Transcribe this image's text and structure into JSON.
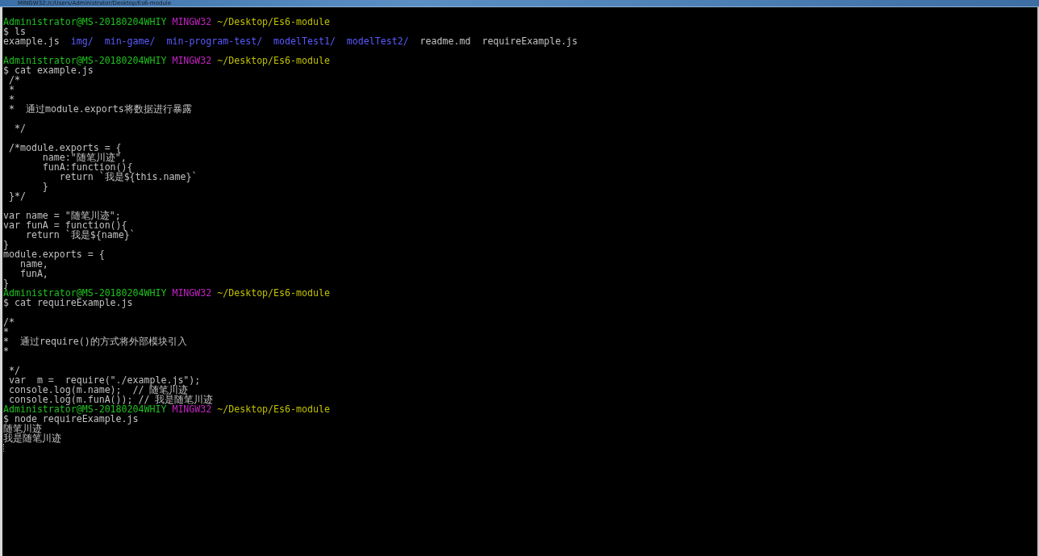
{
  "window": {
    "title": "MINGW32:/c/Users/Administrator/Desktop/Es6-module"
  },
  "terminal": {
    "cursor": true,
    "lines": [
      {
        "kind": "blank"
      },
      {
        "kind": "prompt",
        "segments": [
          {
            "text": "Administrator@MS-20180204WHIY",
            "kind": "user"
          },
          {
            "text": "MINGW32",
            "kind": "system"
          },
          {
            "text": "~/Desktop/Es6-module",
            "kind": "path"
          }
        ]
      },
      {
        "kind": "text",
        "text": "$ ls"
      },
      {
        "kind": "listing",
        "segments": [
          {
            "text": "example.js",
            "kind": "file"
          },
          {
            "text": "img/",
            "kind": "dir"
          },
          {
            "text": "min-game/",
            "kind": "dir"
          },
          {
            "text": "min-program-test/",
            "kind": "dir"
          },
          {
            "text": "modelTest1/",
            "kind": "dir"
          },
          {
            "text": "modelTest2/",
            "kind": "dir"
          },
          {
            "text": "readme.md",
            "kind": "file"
          },
          {
            "text": "requireExample.js",
            "kind": "file"
          }
        ]
      },
      {
        "kind": "blank"
      },
      {
        "kind": "prompt",
        "segments": [
          {
            "text": "Administrator@MS-20180204WHIY",
            "kind": "user"
          },
          {
            "text": "MINGW32",
            "kind": "system"
          },
          {
            "text": "~/Desktop/Es6-module",
            "kind": "path"
          }
        ]
      },
      {
        "kind": "text",
        "text": "$ cat example.js"
      },
      {
        "kind": "text",
        "text": " /*"
      },
      {
        "kind": "text",
        "text": " *"
      },
      {
        "kind": "text",
        "text": " *"
      },
      {
        "kind": "text",
        "text": " *  通过module.exports将数据进行暴露"
      },
      {
        "kind": "blank"
      },
      {
        "kind": "text",
        "text": "  */"
      },
      {
        "kind": "blank"
      },
      {
        "kind": "text",
        "text": " /*module.exports = {"
      },
      {
        "kind": "text",
        "text": "       name:\"随笔川迹\","
      },
      {
        "kind": "text",
        "text": "       funA:function(){"
      },
      {
        "kind": "text",
        "text": "          return `我是${this.name}`"
      },
      {
        "kind": "text",
        "text": "       }"
      },
      {
        "kind": "text",
        "text": " }*/"
      },
      {
        "kind": "blank"
      },
      {
        "kind": "text",
        "text": "var name = \"随笔川迹\";"
      },
      {
        "kind": "text",
        "text": "var funA = function(){"
      },
      {
        "kind": "text",
        "text": "    return `我是${name}`"
      },
      {
        "kind": "text",
        "text": "}"
      },
      {
        "kind": "text",
        "text": "module.exports = {"
      },
      {
        "kind": "text",
        "text": "   name,"
      },
      {
        "kind": "text",
        "text": "   funA,"
      },
      {
        "kind": "text",
        "text": "}"
      },
      {
        "kind": "prompt",
        "segments": [
          {
            "text": "Administrator@MS-20180204WHIY",
            "kind": "user"
          },
          {
            "text": "MINGW32",
            "kind": "system"
          },
          {
            "text": "~/Desktop/Es6-module",
            "kind": "path"
          }
        ]
      },
      {
        "kind": "text",
        "text": "$ cat requireExample.js"
      },
      {
        "kind": "blank"
      },
      {
        "kind": "text",
        "text": "/*"
      },
      {
        "kind": "text",
        "text": "*"
      },
      {
        "kind": "text",
        "text": "*  通过require()的方式将外部模块引入"
      },
      {
        "kind": "text",
        "text": "*"
      },
      {
        "kind": "blank"
      },
      {
        "kind": "text",
        "text": " */"
      },
      {
        "kind": "text",
        "text": " var  m =  require(\"./example.js\");"
      },
      {
        "kind": "text",
        "text": " console.log(m.name);  // 随笔川迹"
      },
      {
        "kind": "text",
        "text": " console.log(m.funA()); // 我是随笔川迹"
      },
      {
        "kind": "prompt",
        "segments": [
          {
            "text": "Administrator@MS-20180204WHIY",
            "kind": "user"
          },
          {
            "text": "MINGW32",
            "kind": "system"
          },
          {
            "text": "~/Desktop/Es6-module",
            "kind": "path"
          }
        ]
      },
      {
        "kind": "text",
        "text": "$ node requireExample.js"
      },
      {
        "kind": "text",
        "text": "随笔川迹"
      },
      {
        "kind": "text",
        "text": "我是随笔川迹"
      }
    ]
  }
}
